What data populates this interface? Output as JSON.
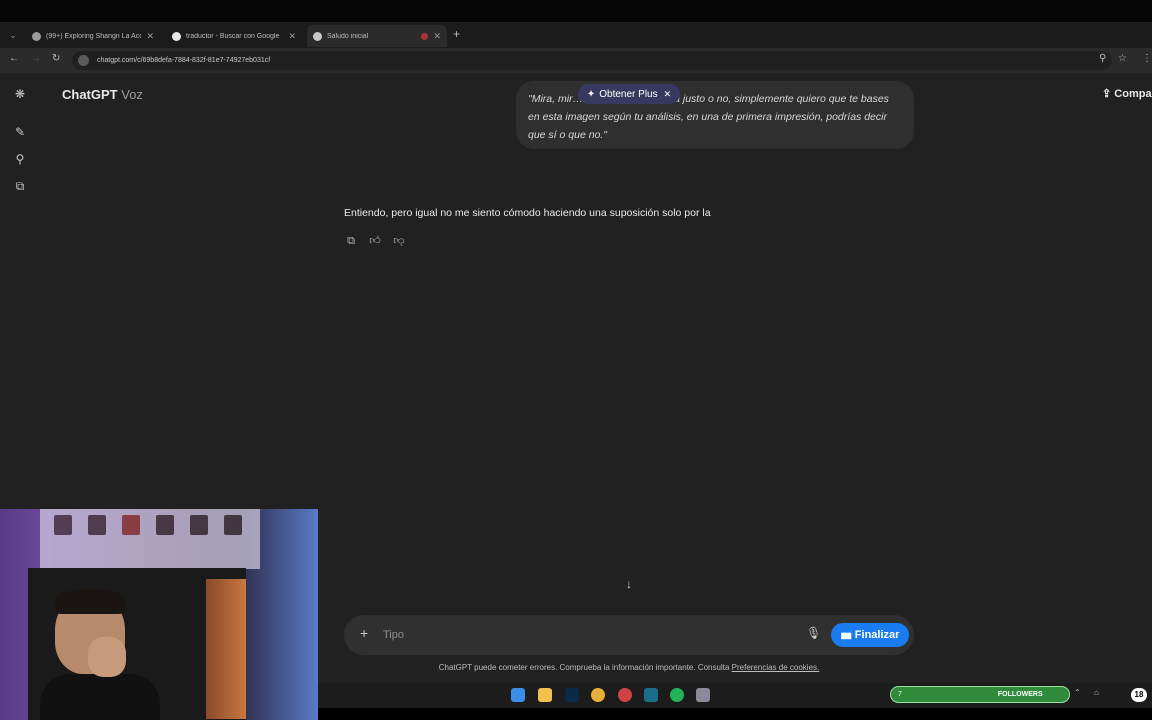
{
  "browser": {
    "tabs": [
      {
        "title": "(99+) Exploring Shangri La Acc",
        "active": false
      },
      {
        "title": "traductor - Buscar con Google",
        "active": false
      },
      {
        "title": "Saludo inicial",
        "active": true
      }
    ],
    "url": "chatgpt.com/c/69b8defa-7884-832f-81e7-74927eb031cf"
  },
  "app": {
    "name": "ChatGPT",
    "mode": "Voz",
    "share_label": "Compa"
  },
  "promo": {
    "label": "Obtener Plus"
  },
  "conversation": {
    "user_message": "\"Mira, mir… oy pidiendo que sea justo o no, simplemente quiero que te bases en esta imagen según tu análisis, en una de primera impresión, podrías decir que sí o que no.\"",
    "assistant_message": "Entiendo, pero igual no me siento cómodo haciendo una suposición solo por la"
  },
  "composer": {
    "placeholder": "Tipo",
    "finalize_label": "Finalizar"
  },
  "disclaimer": {
    "text": "ChatGPT puede cometer errores. Comprueba la información importante. Consulta",
    "link": "Preferencias de cookies."
  },
  "overlay": {
    "followers_count": "7",
    "followers_label": "FOLLOWERS",
    "badge_count": "18"
  },
  "colors": {
    "page_bg": "#212121",
    "accent": "#1a7cf0"
  }
}
